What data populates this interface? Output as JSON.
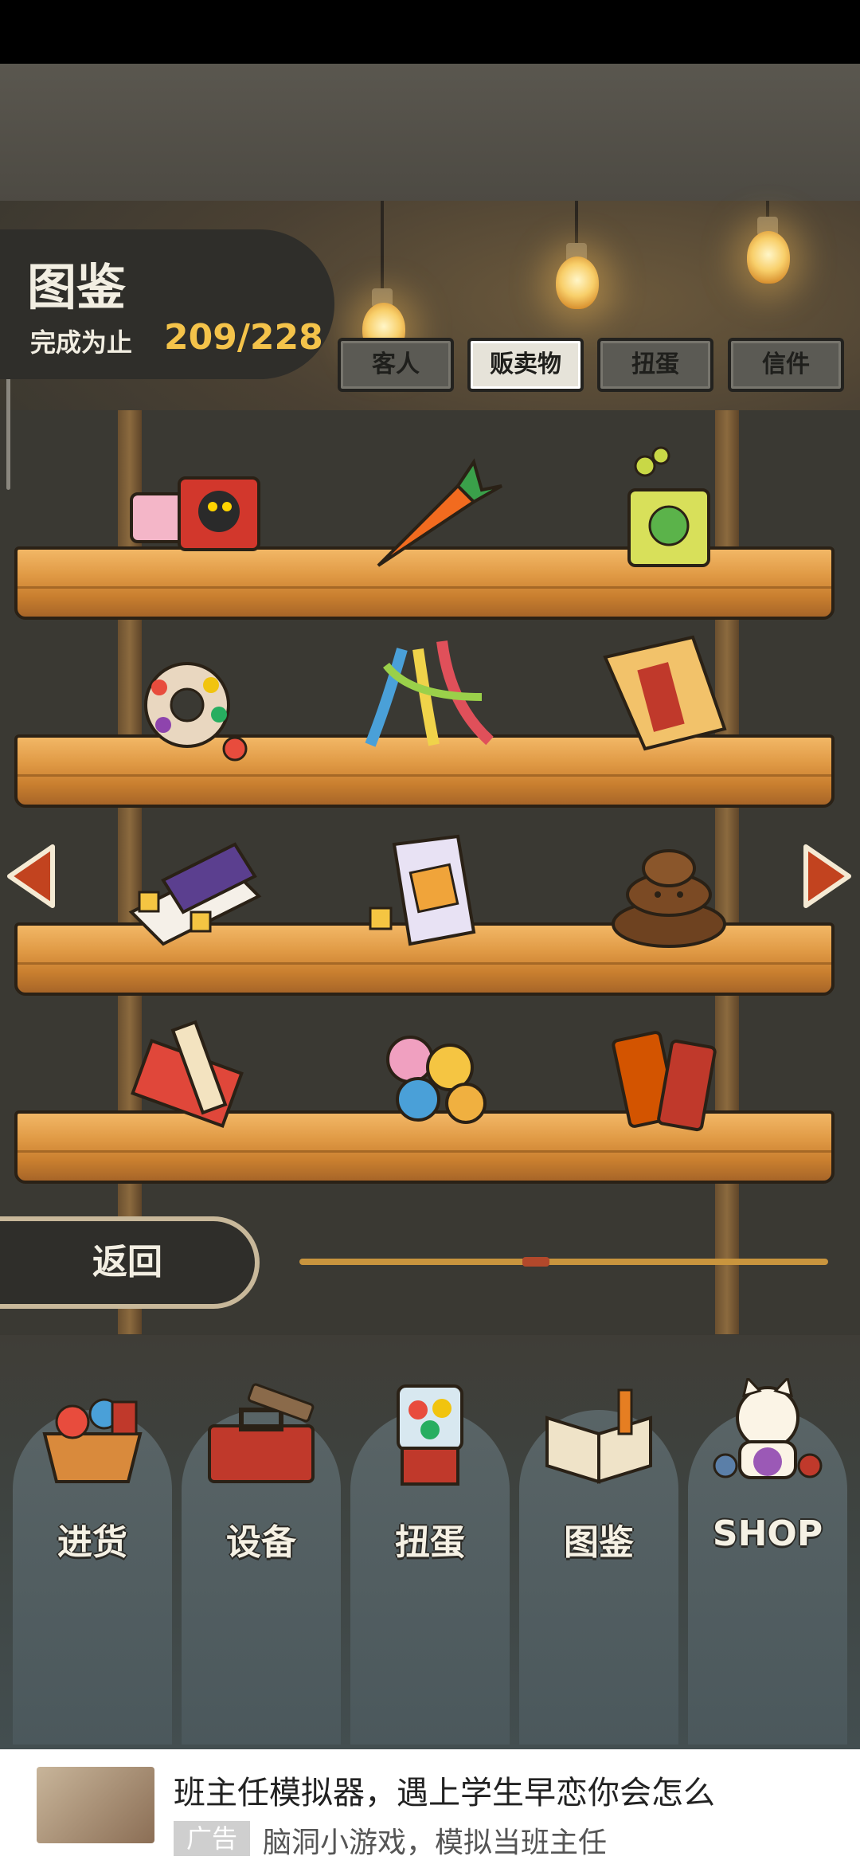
{
  "collection": {
    "title": "图鉴",
    "progress_label": "完成为止",
    "progress_value": "209/228"
  },
  "tabs": [
    {
      "label": "客人",
      "active": false
    },
    {
      "label": "贩卖物",
      "active": true
    },
    {
      "label": "扭蛋",
      "active": false
    },
    {
      "label": "信件",
      "active": false
    }
  ],
  "shelf_items": [
    [
      "candy-box-icon",
      "carrot-snack-icon",
      "frog-chips-bag-icon"
    ],
    [
      "candy-ring-icon",
      "gummy-strings-icon",
      "snack-pack-icon"
    ],
    [
      "ramune-box-icon",
      "candy-bag-icon",
      "chocolate-poop-icon"
    ],
    [
      "wafer-sticks-icon",
      "wrapped-candies-icon",
      "jelly-pouch-icon"
    ]
  ],
  "pagination": {
    "current_fraction": 0.42
  },
  "back_button": "返回",
  "nav": [
    {
      "label": "进货",
      "icon": "basket-icon"
    },
    {
      "label": "设备",
      "icon": "toolbox-icon"
    },
    {
      "label": "扭蛋",
      "icon": "gacha-machine-icon"
    },
    {
      "label": "图鉴",
      "icon": "book-icon"
    },
    {
      "label": "SHOP",
      "icon": "lucky-cat-icon"
    }
  ],
  "ad": {
    "title": "班主任模拟器，遇上学生早恋你会怎么",
    "badge": "广告",
    "description": "脑洞小游戏，模拟当班主任"
  }
}
